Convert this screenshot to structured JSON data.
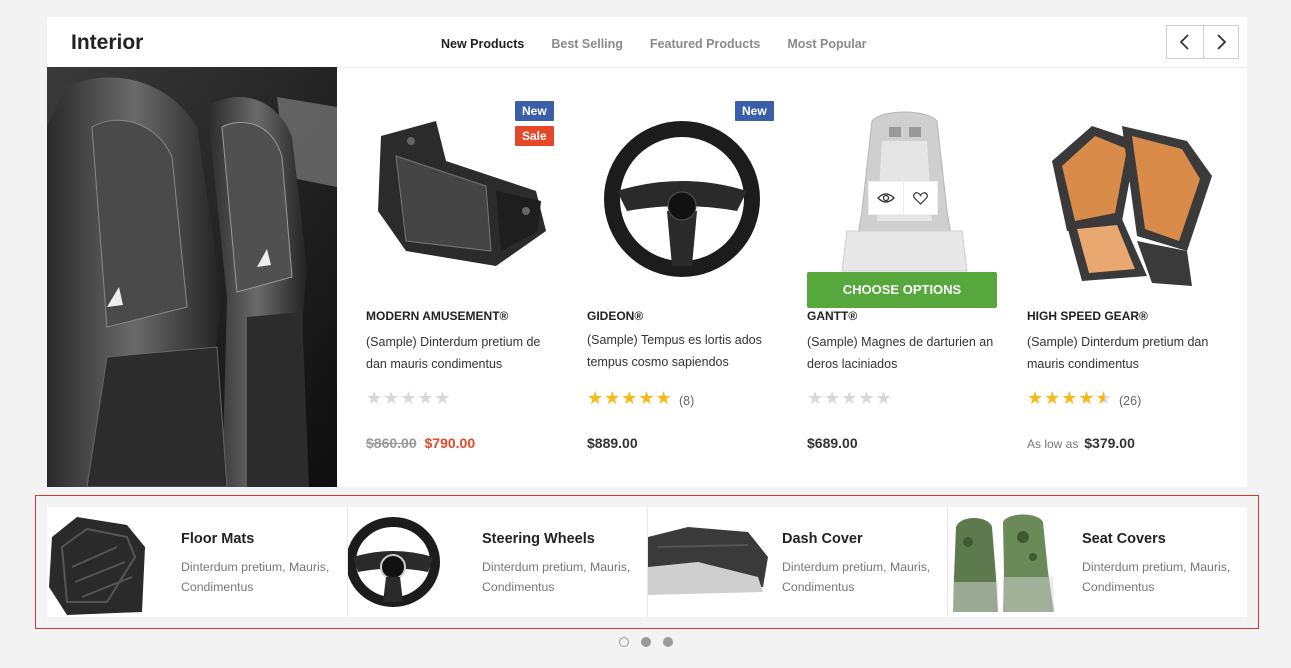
{
  "section": {
    "title": "Interior",
    "tabs": [
      {
        "label": "New Products",
        "active": true
      },
      {
        "label": "Best Selling",
        "active": false
      },
      {
        "label": "Featured Products",
        "active": false
      },
      {
        "label": "Most Popular",
        "active": false
      }
    ],
    "prev_icon": "chevron-left-icon",
    "next_icon": "chevron-right-icon"
  },
  "products": [
    {
      "brand": "MODERN AMUSEMENT®",
      "name": "(Sample) Dinterdum pretium de dan mauris condimentus",
      "badges": [
        "New",
        "Sale"
      ],
      "rating": 0,
      "review_count": "",
      "old_price": "$860.00",
      "price": "$790.00"
    },
    {
      "brand": "GIDEON®",
      "name": "(Sample) Tempus es lortis ados tempus cosmo sapiendos",
      "badges": [
        "New"
      ],
      "rating": 5,
      "review_count": "(8)",
      "price": "$889.00"
    },
    {
      "brand": "GANTT®",
      "name": "(Sample) Magnes de darturien an deros laciniados",
      "badges": [],
      "rating": 0,
      "review_count": "",
      "price": "$689.00",
      "button": "CHOOSE OPTIONS"
    },
    {
      "brand": "HIGH SPEED GEAR®",
      "name": "(Sample) Dinterdum pretium dan mauris condimentus",
      "badges": [],
      "rating": 4.5,
      "review_count": "(26)",
      "price_prefix": "As low as",
      "price": "$379.00"
    }
  ],
  "categories": [
    {
      "title": "Floor Mats",
      "desc": "Dinterdum pretium, Mauris, Condimentus"
    },
    {
      "title": "Steering Wheels",
      "desc": "Dinterdum pretium, Mauris, Condimentus"
    },
    {
      "title": "Dash Cover",
      "desc": "Dinterdum pretium, Mauris, Condimentus"
    },
    {
      "title": "Seat Covers",
      "desc": "Dinterdum pretium, Mauris, Condimentus"
    }
  ],
  "colors": {
    "badge_new": "#3a5fa8",
    "badge_sale": "#e5472b",
    "button_green": "#56a83c",
    "star": "#f6b91a"
  },
  "pagination": {
    "pages": 3,
    "active": 1
  }
}
